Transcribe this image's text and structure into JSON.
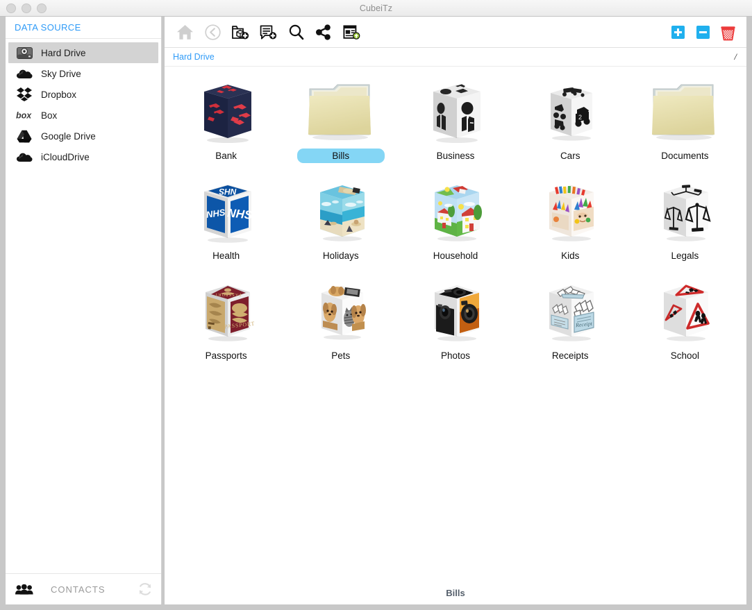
{
  "window": {
    "title": "CubeiTz",
    "traffic_lights": [
      "close",
      "minimize",
      "maximize"
    ]
  },
  "sidebar": {
    "header": "DATA SOURCE",
    "items": [
      {
        "label": "Hard Drive",
        "icon": "hard-drive-icon",
        "selected": true
      },
      {
        "label": "Sky Drive",
        "icon": "sky-drive-icon",
        "selected": false
      },
      {
        "label": "Dropbox",
        "icon": "dropbox-icon",
        "selected": false
      },
      {
        "label": "Box",
        "icon": "box-icon",
        "selected": false
      },
      {
        "label": "Google Drive",
        "icon": "google-drive-icon",
        "selected": false
      },
      {
        "label": "iCloudDrive",
        "icon": "icloud-drive-icon",
        "selected": false
      }
    ],
    "footer": {
      "label": "CONTACTS",
      "icon": "contacts-people-icon",
      "refresh_icon": "refresh-icon"
    }
  },
  "toolbar": {
    "buttons": [
      {
        "name": "home-icon",
        "title": "Home",
        "disabled": true
      },
      {
        "name": "back-icon",
        "title": "Back",
        "disabled": true
      },
      {
        "name": "add-cube-icon",
        "title": "Add Cube",
        "disabled": false
      },
      {
        "name": "add-note-icon",
        "title": "Add Note",
        "disabled": false
      },
      {
        "name": "search-icon",
        "title": "Search",
        "disabled": false
      },
      {
        "name": "share-icon",
        "title": "Share",
        "disabled": false
      },
      {
        "name": "upload-icon",
        "title": "Upload",
        "disabled": false
      }
    ],
    "right_buttons": [
      {
        "name": "zoom-in-button",
        "label": "+"
      },
      {
        "name": "zoom-out-button",
        "label": "−"
      },
      {
        "name": "trash-button",
        "label": "Trash"
      }
    ]
  },
  "breadcrumb": {
    "current": "Hard Drive",
    "path": "/"
  },
  "grid": {
    "items": [
      {
        "label": "Bank",
        "type": "cube",
        "selected": false,
        "art": "bank"
      },
      {
        "label": "Bills",
        "type": "folder",
        "selected": true,
        "art": "folder"
      },
      {
        "label": "Business",
        "type": "cube",
        "selected": false,
        "art": "business"
      },
      {
        "label": "Cars",
        "type": "cube",
        "selected": false,
        "art": "cars"
      },
      {
        "label": "Documents",
        "type": "folder",
        "selected": false,
        "art": "folder"
      },
      {
        "label": "Health",
        "type": "cube",
        "selected": false,
        "art": "health"
      },
      {
        "label": "Holidays",
        "type": "cube",
        "selected": false,
        "art": "holidays"
      },
      {
        "label": "Household",
        "type": "cube",
        "selected": false,
        "art": "household"
      },
      {
        "label": "Kids",
        "type": "cube",
        "selected": false,
        "art": "kids"
      },
      {
        "label": "Legals",
        "type": "cube",
        "selected": false,
        "art": "legals"
      },
      {
        "label": "Passports",
        "type": "cube",
        "selected": false,
        "art": "passports"
      },
      {
        "label": "Pets",
        "type": "cube",
        "selected": false,
        "art": "pets"
      },
      {
        "label": "Photos",
        "type": "cube",
        "selected": false,
        "art": "photos"
      },
      {
        "label": "Receipts",
        "type": "cube",
        "selected": false,
        "art": "receipts"
      },
      {
        "label": "School",
        "type": "cube",
        "selected": false,
        "art": "school"
      }
    ]
  },
  "statusbar": {
    "text": "Bills"
  },
  "colors": {
    "accent_blue": "#2f9bf7",
    "selection_blue": "#84d6f5",
    "toolbar_blue": "#20b0ee",
    "trash_red": "#ec3b3b",
    "sidebar_selected": "#d3d3d3",
    "window_chrome": "#c8c8c8"
  }
}
